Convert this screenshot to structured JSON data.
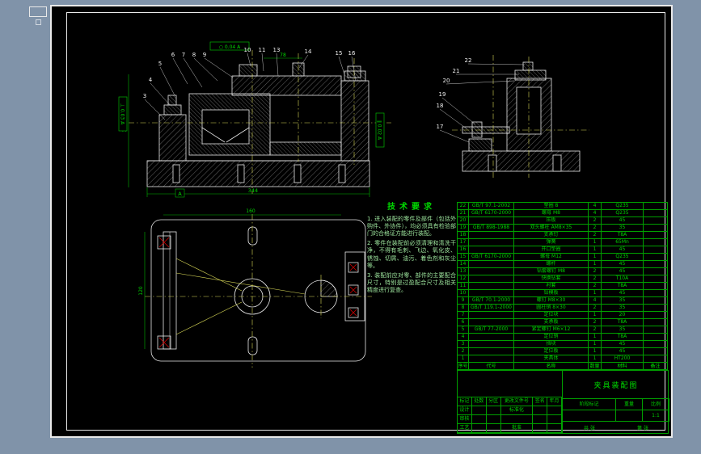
{
  "balloons": {
    "main": [
      "3",
      "4",
      "5",
      "6",
      "7",
      "8",
      "9",
      "10",
      "11",
      "13",
      "14",
      "15",
      "16"
    ],
    "side": [
      "22",
      "21",
      "20",
      "19",
      "18",
      "17"
    ]
  },
  "dims": {
    "main_width": "344",
    "main_top": "78",
    "main_left": "160",
    "plan_width": "160",
    "plan_height": "120",
    "datum_a": "A"
  },
  "fcf": {
    "f1": "○ 0.04 A",
    "f2": "⊥ 0.03 A",
    "f3": "∥ 0.02 A"
  },
  "tech_req": {
    "title": "技术要求",
    "items": [
      "1. 进入装配的零件及部件（包括外购件、外协件），均必须具有检验部门的合格证方能进行装配。",
      "2. 零件在装配前必须清理和清洗干净，不得有毛刺、飞边、氧化皮、锈蚀、切屑、油污、着色剂和灰尘等。",
      "3. 装配前应对零、部件的主要配合尺寸，特别是过盈配合尺寸及相关精度进行复查。"
    ]
  },
  "bom": {
    "headers": [
      "序号",
      "代号",
      "名称",
      "数量",
      "材料",
      "备注"
    ],
    "rows": [
      [
        "22",
        "GB/T 97.1-2002",
        "垫圈 8",
        "4",
        "Q235",
        ""
      ],
      [
        "21",
        "GB/T 6170-2000",
        "螺母 M8",
        "4",
        "Q235",
        ""
      ],
      [
        "20",
        "",
        "压板",
        "2",
        "45",
        ""
      ],
      [
        "19",
        "GB/T 898-1988",
        "双头螺柱 AM8×35",
        "2",
        "35",
        ""
      ],
      [
        "18",
        "",
        "支承钉",
        "2",
        "T8A",
        ""
      ],
      [
        "17",
        "",
        "弹簧",
        "1",
        "65Mn",
        ""
      ],
      [
        "16",
        "",
        "开口垫圈",
        "1",
        "45",
        ""
      ],
      [
        "15",
        "GB/T 6170-2000",
        "螺母 M12",
        "1",
        "Q235",
        ""
      ],
      [
        "14",
        "",
        "螺杆",
        "1",
        "45",
        ""
      ],
      [
        "13",
        "",
        "钻套螺钉 M8",
        "2",
        "45",
        ""
      ],
      [
        "12",
        "",
        "快换钻套",
        "2",
        "T10A",
        ""
      ],
      [
        "11",
        "",
        "衬套",
        "2",
        "T8A",
        ""
      ],
      [
        "10",
        "",
        "钻模板",
        "1",
        "45",
        ""
      ],
      [
        "9",
        "GB/T 70.1-2000",
        "螺钉 M8×30",
        "4",
        "35",
        ""
      ],
      [
        "8",
        "GB/T 119.1-2000",
        "圆柱销 8×30",
        "2",
        "35",
        ""
      ],
      [
        "7",
        "",
        "定位块",
        "1",
        "20",
        ""
      ],
      [
        "6",
        "",
        "支承板",
        "2",
        "T8A",
        ""
      ],
      [
        "5",
        "GB/T 77-2000",
        "紧定螺钉 M6×12",
        "2",
        "35",
        ""
      ],
      [
        "4",
        "",
        "定位销",
        "1",
        "T8A",
        ""
      ],
      [
        "3",
        "",
        "挡块",
        "1",
        "45",
        ""
      ],
      [
        "2",
        "",
        "定位板",
        "1",
        "45",
        ""
      ],
      [
        "1",
        "",
        "夹具体",
        "1",
        "HT200",
        ""
      ]
    ]
  },
  "title_block": {
    "mark": "标记",
    "count": "处数",
    "zone": "分区",
    "change_doc": "更改文件号",
    "sign": "签名",
    "date": "年月日",
    "design": "设计",
    "check": "审核",
    "process": "工艺",
    "standard": "标准化",
    "approve": "批准",
    "stage": "阶段标记",
    "weight": "重量",
    "scale": "比例",
    "scale_value": "1:1",
    "sheets": "共 张",
    "sheet_no": "第 张",
    "title": "夹具装配图"
  }
}
